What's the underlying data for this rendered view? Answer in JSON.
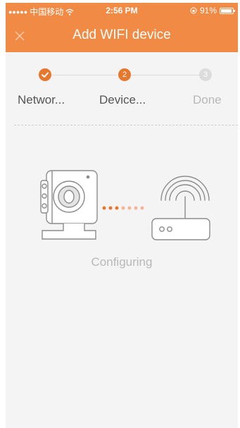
{
  "status_bar": {
    "carrier": "中国移动",
    "time": "2:56 PM",
    "battery": "91%",
    "battery_level": 0.91
  },
  "nav": {
    "title": "Add WIFI device",
    "close_icon": "close-icon"
  },
  "steps": [
    {
      "number": "1",
      "label": "Networ...",
      "state": "done"
    },
    {
      "number": "2",
      "label": "Device...",
      "state": "current"
    },
    {
      "number": "3",
      "label": "Done",
      "state": "pending"
    }
  ],
  "main": {
    "status_text": "Configuring"
  },
  "colors": {
    "accent": "#f08a44",
    "active_step": "#e8772e",
    "inactive_step": "#dcdcdc",
    "dot_bright": "#e8772e",
    "dot_faded": "#f4b692",
    "status_text": "#b8b8b8",
    "step_label_active": "#555555",
    "step_label_inactive": "#b8b8b8"
  }
}
